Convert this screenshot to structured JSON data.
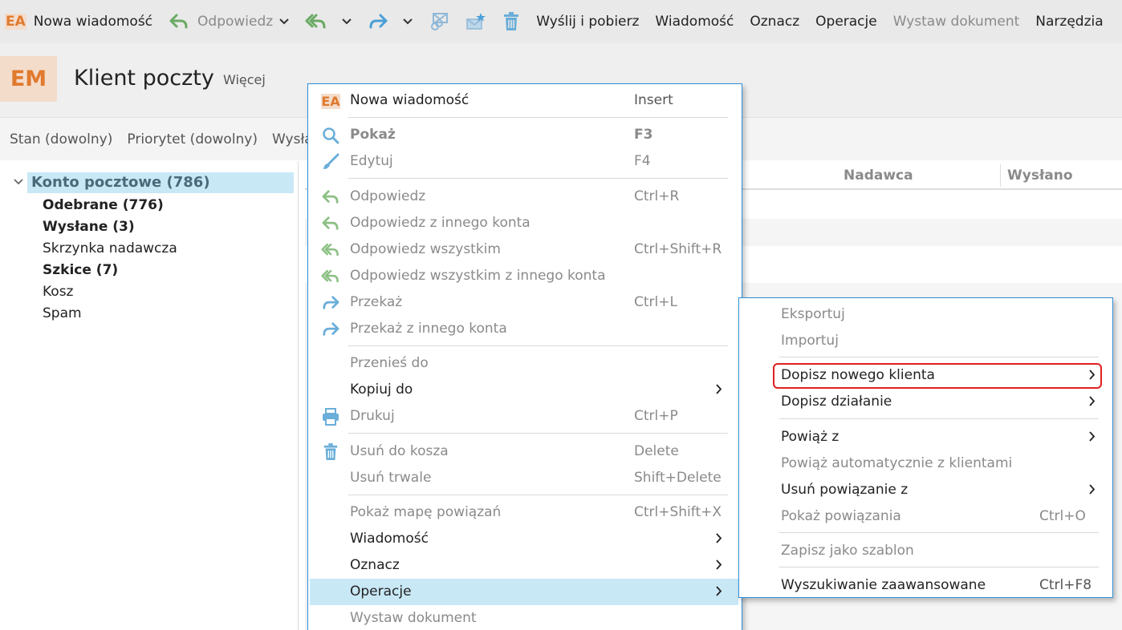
{
  "toolbar": {
    "logo": "EA",
    "items": [
      {
        "label": "Nowa wiadomość",
        "enabled": true
      },
      {
        "label": "Odpowiedz",
        "enabled": false
      },
      {
        "label": "Wyślij i pobierz",
        "enabled": true
      },
      {
        "label": "Wiadomość",
        "enabled": true
      },
      {
        "label": "Oznacz",
        "enabled": true
      },
      {
        "label": "Operacje",
        "enabled": true
      },
      {
        "label": "Wystaw dokument",
        "enabled": false
      },
      {
        "label": "Narzędzia",
        "enabled": true
      }
    ]
  },
  "header": {
    "logo": "EM",
    "title": "Klient poczty",
    "more": "Więcej"
  },
  "filters": [
    "Stan (dowolny)",
    "Priorytet (dowolny)",
    "Wysłano"
  ],
  "tree": {
    "root": "Konto pocztowe (786)",
    "items": [
      {
        "label": "Odebrane (776)",
        "bold": true
      },
      {
        "label": "Wysłane (3)",
        "bold": true
      },
      {
        "label": "Skrzynka nadawcza",
        "bold": false
      },
      {
        "label": "Szkice (7)",
        "bold": true
      },
      {
        "label": "Kosz",
        "bold": false
      },
      {
        "label": "Spam",
        "bold": false
      }
    ]
  },
  "grid": {
    "columns": [
      "Nadawca",
      "Wysłano"
    ]
  },
  "context_menu": {
    "items": [
      {
        "icon": "ea-logo",
        "label": "Nowa wiadomość",
        "shortcut": "Insert",
        "enabled": true
      },
      {
        "icon": "search-icon",
        "label": "Pokaż",
        "shortcut": "F3",
        "enabled": false,
        "bold": true
      },
      {
        "icon": "brush-icon",
        "label": "Edytuj",
        "shortcut": "F4",
        "enabled": false
      },
      {
        "icon": "reply-icon",
        "label": "Odpowiedz",
        "shortcut": "Ctrl+R",
        "enabled": false
      },
      {
        "icon": "reply-icon",
        "label": "Odpowiedz z innego konta",
        "shortcut": "",
        "enabled": false
      },
      {
        "icon": "reply-all-icon",
        "label": "Odpowiedz wszystkim",
        "shortcut": "Ctrl+Shift+R",
        "enabled": false
      },
      {
        "icon": "reply-all-icon",
        "label": "Odpowiedz wszystkim z innego konta",
        "shortcut": "",
        "enabled": false
      },
      {
        "icon": "forward-icon",
        "label": "Przekaż",
        "shortcut": "Ctrl+L",
        "enabled": false
      },
      {
        "icon": "forward-icon",
        "label": "Przekaż z innego konta",
        "shortcut": "",
        "enabled": false
      },
      {
        "icon": "",
        "label": "Przenieś do",
        "shortcut": "",
        "enabled": false
      },
      {
        "icon": "",
        "label": "Kopiuj do",
        "shortcut": "",
        "enabled": true,
        "submenu": true
      },
      {
        "icon": "printer-icon",
        "label": "Drukuj",
        "shortcut": "Ctrl+P",
        "enabled": false
      },
      {
        "icon": "trash-icon",
        "label": "Usuń do kosza",
        "shortcut": "Delete",
        "enabled": false
      },
      {
        "icon": "",
        "label": "Usuń trwale",
        "shortcut": "Shift+Delete",
        "enabled": false
      },
      {
        "icon": "",
        "label": "Pokaż mapę powiązań",
        "shortcut": "Ctrl+Shift+X",
        "enabled": false
      },
      {
        "icon": "",
        "label": "Wiadomość",
        "shortcut": "",
        "enabled": true,
        "submenu": true
      },
      {
        "icon": "",
        "label": "Oznacz",
        "shortcut": "",
        "enabled": true,
        "submenu": true
      },
      {
        "icon": "",
        "label": "Operacje",
        "shortcut": "",
        "enabled": true,
        "submenu": true,
        "active": true
      },
      {
        "icon": "",
        "label": "Wystaw dokument",
        "shortcut": "",
        "enabled": false
      }
    ]
  },
  "submenu": {
    "items": [
      {
        "label": "Eksportuj",
        "shortcut": "",
        "enabled": false
      },
      {
        "label": "Importuj",
        "shortcut": "",
        "enabled": false
      },
      {
        "label": "Dopisz nowego klienta",
        "shortcut": "",
        "enabled": true,
        "submenu": true,
        "highlighted": true
      },
      {
        "label": "Dopisz działanie",
        "shortcut": "",
        "enabled": true,
        "submenu": true
      },
      {
        "label": "Powiąż z",
        "shortcut": "",
        "enabled": true,
        "submenu": true
      },
      {
        "label": "Powiąż automatycznie z klientami",
        "shortcut": "",
        "enabled": false
      },
      {
        "label": "Usuń powiązanie z",
        "shortcut": "",
        "enabled": true,
        "submenu": true
      },
      {
        "label": "Pokaż powiązania",
        "shortcut": "Ctrl+O",
        "enabled": false
      },
      {
        "label": "Zapisz jako szablon",
        "shortcut": "",
        "enabled": false
      },
      {
        "label": "Wyszukiwanie zaawansowane",
        "shortcut": "Ctrl+F8",
        "enabled": true
      }
    ]
  },
  "colors": {
    "accent_orange": "#e07a2e",
    "selection_blue": "#c9e8f6",
    "menu_border": "#2f8fd8",
    "highlight_red": "#e02020",
    "reply_green": "#6aaa64",
    "forward_blue": "#4a9fd6"
  }
}
